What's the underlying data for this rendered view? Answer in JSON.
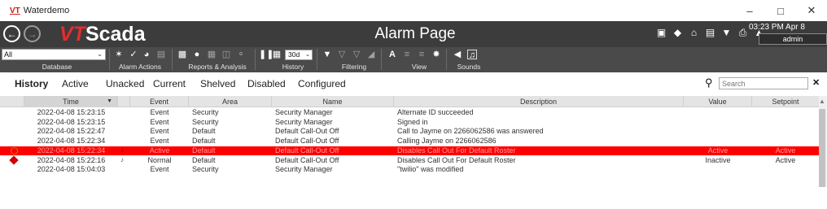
{
  "window": {
    "logo": "VT",
    "title": "Waterdemo",
    "controls": [
      "–",
      "□",
      "✕"
    ]
  },
  "header": {
    "brand_vt": "VT",
    "brand_rest": "Scada",
    "page_title": "Alarm Page",
    "clock": "03:23 PM  Apr 8",
    "user": "admin",
    "icons": [
      "report-icon",
      "tag-icon",
      "home-icon",
      "list-icon",
      "filter-icon",
      "print-icon",
      "speaker-icon"
    ]
  },
  "toolbar": {
    "database_value": "All",
    "group_labels": {
      "database": "Database",
      "alarm_actions": "Alarm Actions",
      "reports": "Reports & Analysis",
      "history": "History",
      "filtering": "Filtering",
      "view": "View",
      "sounds": "Sounds"
    },
    "history_range": "30d"
  },
  "tabs": [
    {
      "label": "History",
      "active": true
    },
    {
      "label": "Active",
      "active": false
    },
    {
      "label": "Unacked",
      "active": false
    },
    {
      "label": "Current",
      "active": false
    },
    {
      "label": "Shelved",
      "active": false
    },
    {
      "label": "Disabled",
      "active": false
    },
    {
      "label": "Configured",
      "active": false
    }
  ],
  "search": {
    "placeholder": "Search"
  },
  "table": {
    "columns": [
      "Time",
      "Event",
      "Area",
      "Name",
      "Description",
      "Value",
      "Setpoint"
    ],
    "rows": [
      {
        "time": "2022-04-08  15:23:15",
        "event": "Event",
        "area": "Security",
        "name": "Security Manager",
        "description": "Alternate ID succeeded",
        "value": "",
        "setpoint": "",
        "state": "event"
      },
      {
        "time": "2022-04-08  15:23:15",
        "event": "Event",
        "area": "Security",
        "name": "Security Manager",
        "description": "Signed in",
        "value": "",
        "setpoint": "",
        "state": "event"
      },
      {
        "time": "2022-04-08  15:22:47",
        "event": "Event",
        "area": "Default",
        "name": "Default Call-Out Off",
        "description": "Call to Jayme on 2266062586 was answered",
        "value": "",
        "setpoint": "",
        "state": "event"
      },
      {
        "time": "2022-04-08  15:22:34",
        "event": "Event",
        "area": "Default",
        "name": "Default Call-Out Off",
        "description": "Calling Jayme on 2266062586",
        "value": "",
        "setpoint": "",
        "state": "event"
      },
      {
        "time": "2022-04-08  15:22:34",
        "event": "Active",
        "area": "Default",
        "name": "Default Call-Out Off",
        "description": "Disables Call Out For Default Roster",
        "value": "Active",
        "setpoint": "Active",
        "state": "active"
      },
      {
        "time": "2022-04-08  15:22:16",
        "event": "Normal",
        "area": "Default",
        "name": "Default Call-Out Off",
        "description": "Disables Call Out For Default Roster",
        "value": "Inactive",
        "setpoint": "Active",
        "state": "normal"
      },
      {
        "time": "2022-04-08  15:04:03",
        "event": "Event",
        "area": "Security",
        "name": "Security Manager",
        "description": "\"twilio\" was modified",
        "value": "",
        "setpoint": "",
        "state": "event"
      }
    ]
  }
}
